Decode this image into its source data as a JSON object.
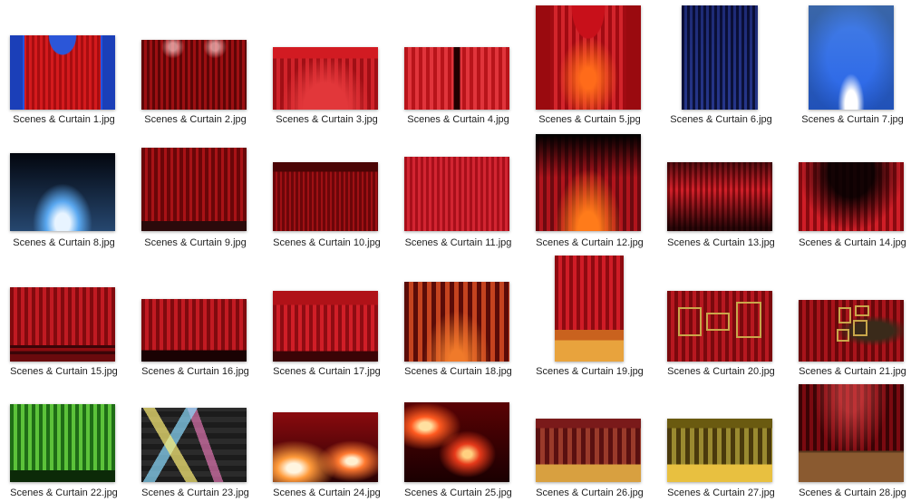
{
  "items": [
    {
      "label": "Scenes & Curtain 1.jpg"
    },
    {
      "label": "Scenes & Curtain 2.jpg"
    },
    {
      "label": "Scenes & Curtain 3.jpg"
    },
    {
      "label": "Scenes & Curtain 4.jpg"
    },
    {
      "label": "Scenes & Curtain 5.jpg"
    },
    {
      "label": "Scenes & Curtain 6.jpg"
    },
    {
      "label": "Scenes & Curtain 7.jpg"
    },
    {
      "label": "Scenes & Curtain 8.jpg"
    },
    {
      "label": "Scenes & Curtain 9.jpg"
    },
    {
      "label": "Scenes & Curtain 10.jpg"
    },
    {
      "label": "Scenes & Curtain 11.jpg"
    },
    {
      "label": "Scenes & Curtain 12.jpg"
    },
    {
      "label": "Scenes & Curtain 13.jpg"
    },
    {
      "label": "Scenes & Curtain 14.jpg"
    },
    {
      "label": "Scenes & Curtain 15.jpg"
    },
    {
      "label": "Scenes & Curtain 16.jpg"
    },
    {
      "label": "Scenes & Curtain 17.jpg"
    },
    {
      "label": "Scenes & Curtain 18.jpg"
    },
    {
      "label": "Scenes & Curtain 19.jpg"
    },
    {
      "label": "Scenes & Curtain 20.jpg"
    },
    {
      "label": "Scenes & Curtain 21.jpg"
    },
    {
      "label": "Scenes & Curtain 22.jpg"
    },
    {
      "label": "Scenes & Curtain 23.jpg"
    },
    {
      "label": "Scenes & Curtain 24.jpg"
    },
    {
      "label": "Scenes & Curtain 25.jpg"
    },
    {
      "label": "Scenes & Curtain 26.jpg"
    },
    {
      "label": "Scenes & Curtain 27.jpg"
    },
    {
      "label": "Scenes & Curtain 28.jpg"
    }
  ]
}
